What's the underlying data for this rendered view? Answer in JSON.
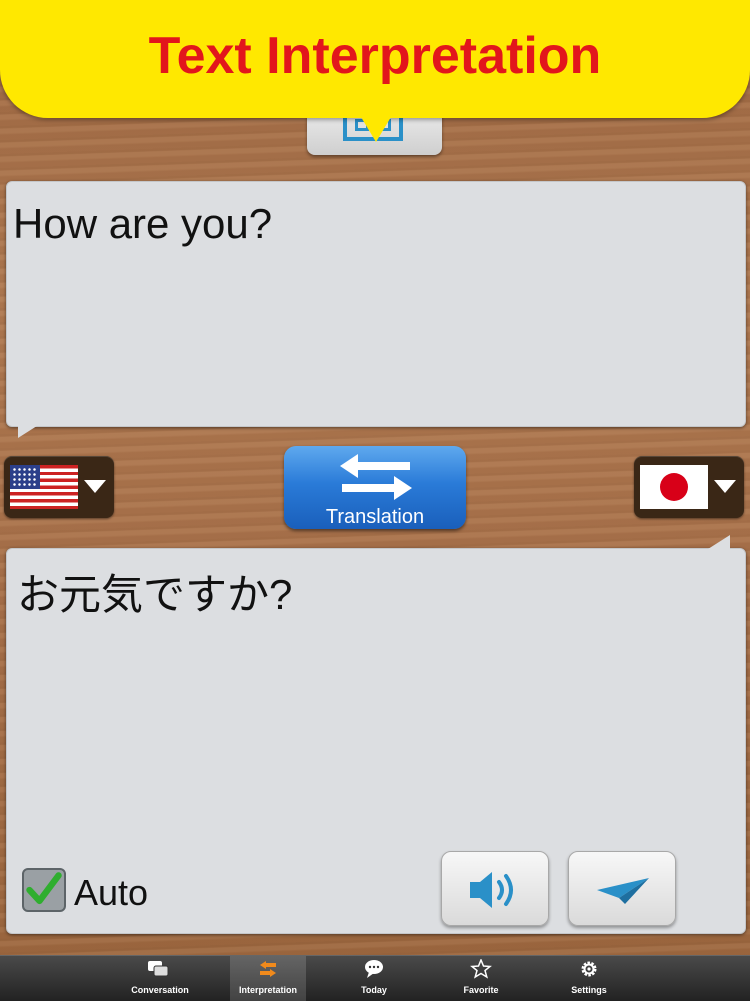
{
  "banner": {
    "title": "Text Interpretation"
  },
  "source": {
    "text": "How are you?",
    "language": "English (US)",
    "flag_icon": "us-flag-icon"
  },
  "target": {
    "text": "お元気ですか?",
    "language": "Japanese",
    "flag_icon": "japan-flag-icon"
  },
  "translate_button": {
    "label": "Translation"
  },
  "auto": {
    "label": "Auto",
    "checked": true
  },
  "actions": {
    "speak_icon": "speaker-icon",
    "send_icon": "paper-plane-icon"
  },
  "tabs": [
    {
      "label": "Conversation",
      "icon": "chat-bubbles-icon",
      "active": false
    },
    {
      "label": "Interpretation",
      "icon": "swap-arrows-icon",
      "active": true
    },
    {
      "label": "Today",
      "icon": "speech-bubble-icon",
      "active": false
    },
    {
      "label": "Favorite",
      "icon": "star-icon",
      "active": false
    },
    {
      "label": "Settings",
      "icon": "gear-icon",
      "active": false
    }
  ],
  "colors": {
    "banner_bg": "#ffe800",
    "banner_text": "#e2161c",
    "accent_blue": "#2a7bd8",
    "active_tab_icon": "#f08a1c"
  }
}
